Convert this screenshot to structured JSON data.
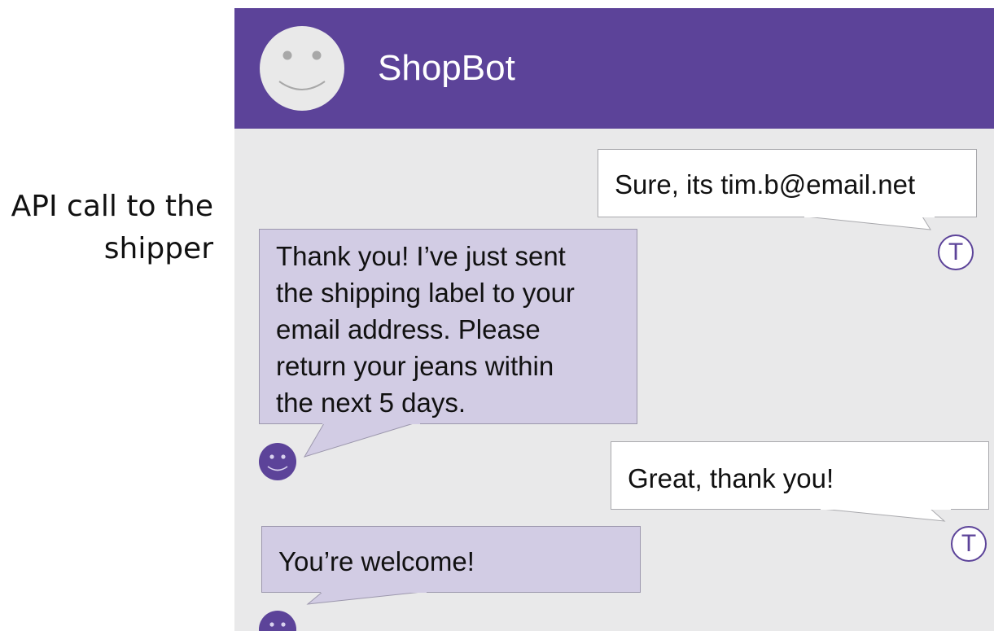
{
  "annotation": {
    "line1": "API call to the",
    "line2": "shipper"
  },
  "header": {
    "title": "ShopBot",
    "avatar_icon": "smiley-face-icon"
  },
  "messages": [
    {
      "from": "user",
      "text": "Sure, its tim.b@email.net",
      "avatar_initial": "T"
    },
    {
      "from": "bot",
      "lines": [
        "Thank you! I’ve just sent",
        "the shipping label to your",
        "email address. Please",
        "return your jeans within",
        "the next 5 days."
      ]
    },
    {
      "from": "user",
      "text": "Great, thank you!",
      "avatar_initial": "T"
    },
    {
      "from": "bot",
      "text": "You’re welcome!"
    }
  ],
  "colors": {
    "header": "#5c4399",
    "chat_background": "#e9e9ea",
    "bot_bubble": "#d2cce4",
    "user_bubble": "#ffffff"
  }
}
